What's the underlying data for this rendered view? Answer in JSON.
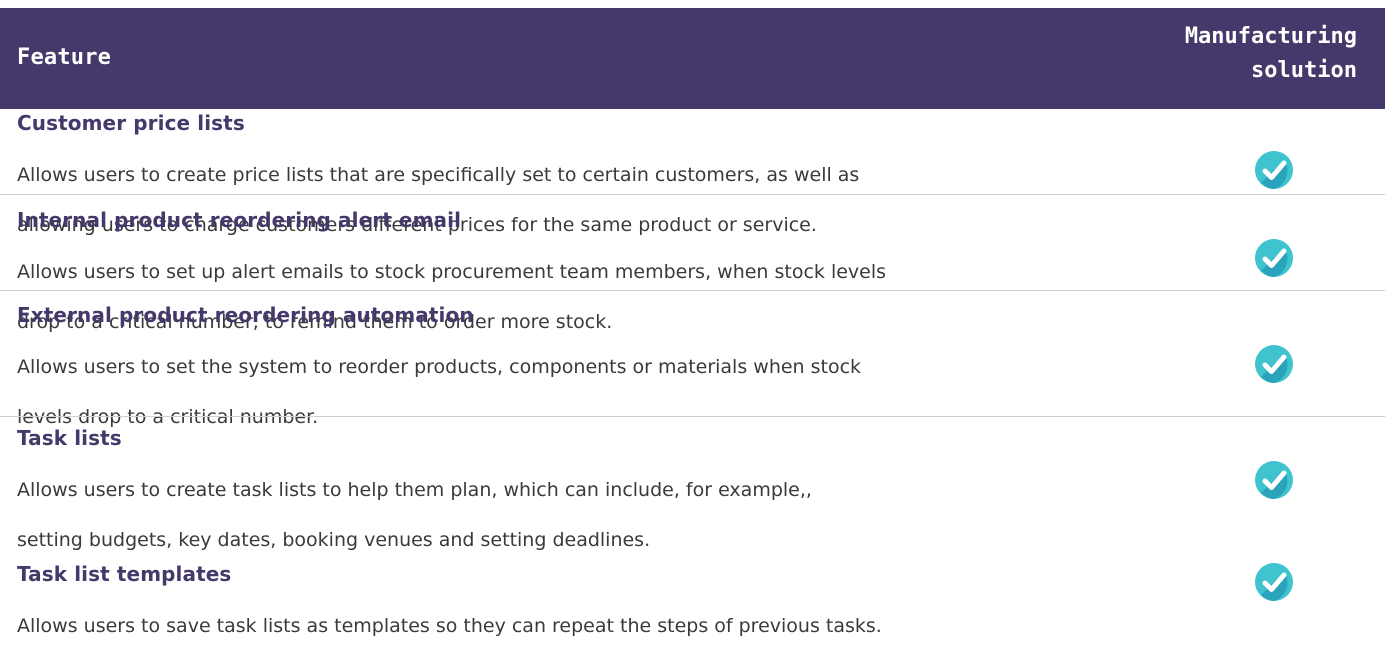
{
  "header": {
    "feature_label": "Feature",
    "solution_line1": "Manufacturing",
    "solution_line2": "solution"
  },
  "colors": {
    "header_bg": "#45386a",
    "title_color": "#45386a",
    "check_light": "#3ec3cf",
    "check_dark": "#1f8fa8"
  },
  "features": [
    {
      "title": "Customer price lists",
      "description_line1": "Allows users to create price lists that are specifically set to certain customers, as well as",
      "description_line2": "allowing users to charge customers different prices for the same product or service.",
      "available_icon": "check-circle-icon"
    },
    {
      "title": "Internal product reordering alert email",
      "description_line1": "Allows users to set up alert emails to stock procurement team members, when stock levels",
      "description_line2": "drop to a critical number, to remind them to order more stock.",
      "available_icon": "check-circle-icon"
    },
    {
      "title": "External product reordering automation",
      "description_line1": "Allows users to set the system to reorder products, components or materials when stock",
      "description_line2": "levels drop to a critical number.",
      "available_icon": "check-circle-icon"
    },
    {
      "title": "Task lists",
      "description_line1": "Allows users to create task lists to help them plan, which can include, for example,,",
      "description_line2": "setting budgets, key dates, booking venues and setting deadlines.",
      "available_icon": "check-circle-icon"
    },
    {
      "title": "Task list templates",
      "description_line1": "Allows users to save task lists as templates so they can repeat the steps of previous tasks.",
      "description_line2": "",
      "available_icon": "check-circle-icon"
    }
  ]
}
